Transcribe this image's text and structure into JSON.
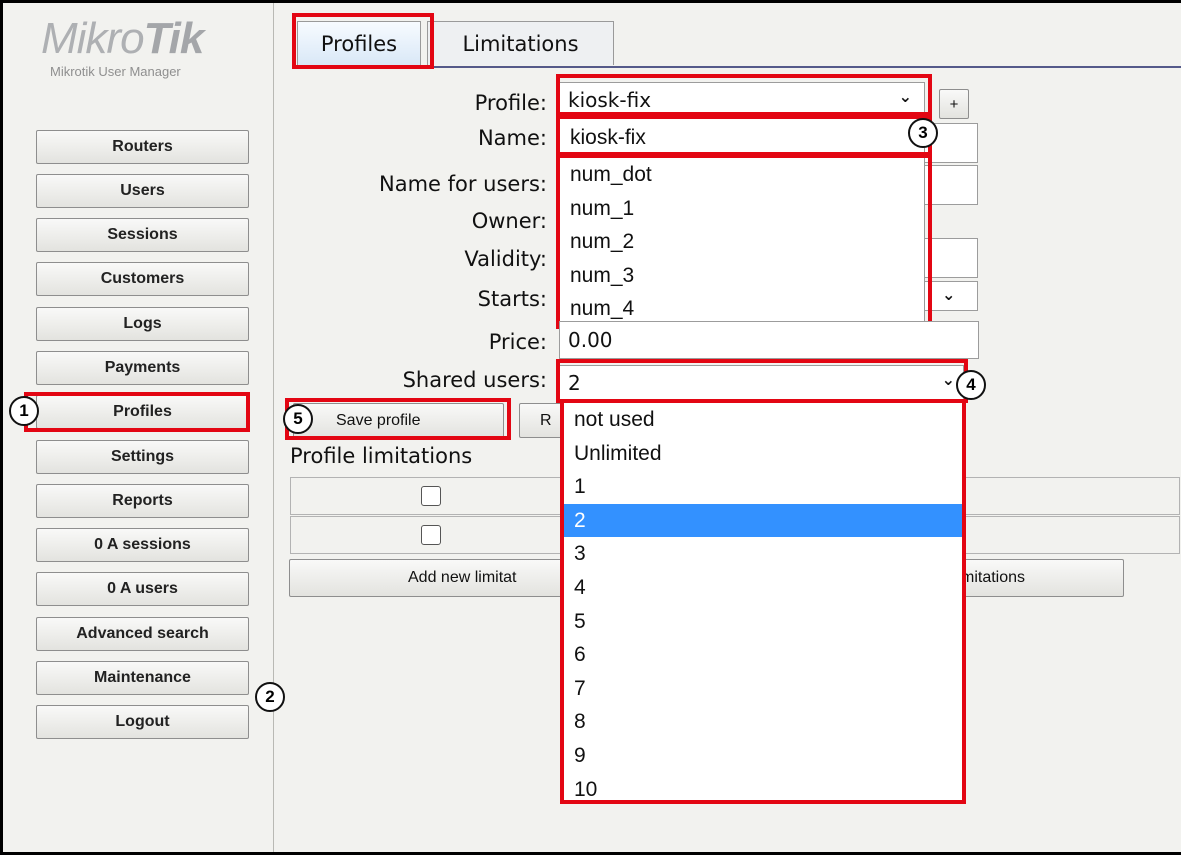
{
  "brand": {
    "logo_light": "Mikro",
    "logo_bold": "Tik",
    "subtitle": "Mikrotik User Manager"
  },
  "sidebar": {
    "items": [
      {
        "label": "Routers"
      },
      {
        "label": "Users"
      },
      {
        "label": "Sessions"
      },
      {
        "label": "Customers"
      },
      {
        "label": "Logs"
      },
      {
        "label": "Payments"
      },
      {
        "label": "Profiles"
      },
      {
        "label": "Settings"
      },
      {
        "label": "Reports"
      },
      {
        "label": "0 A sessions"
      },
      {
        "label": "0 A users"
      },
      {
        "label": "Advanced search"
      },
      {
        "label": "Maintenance"
      },
      {
        "label": "Logout"
      }
    ]
  },
  "tabs": [
    {
      "label": "Profiles",
      "active": true
    },
    {
      "label": "Limitations",
      "active": false
    }
  ],
  "form": {
    "profile_label": "Profile:",
    "profile_value": "kiosk-fix",
    "add_label": "+",
    "name_label": "Name:",
    "name_value": "kiosk-fix",
    "name_for_users_label": "Name for users:",
    "owner_label": "Owner:",
    "validity_label": "Validity:",
    "starts_label": "Starts:",
    "price_label": "Price:",
    "price_value": "0.00",
    "shared_users_label": "Shared users:",
    "shared_users_value": "2"
  },
  "profile_dropdown": {
    "options": [
      "num_dot",
      "num_1",
      "num_2",
      "num_3",
      "num_4"
    ]
  },
  "shared_users_dropdown": {
    "options": [
      "not used",
      "Unlimited",
      "1",
      "2",
      "3",
      "4",
      "5",
      "6",
      "7",
      "8",
      "9",
      "10"
    ],
    "selected": "2"
  },
  "buttons": {
    "save_profile": "Save profile",
    "remove_partial": "R",
    "add_limitation": "Add new limitat",
    "limitations_partial": "mitations"
  },
  "limitations": {
    "title": "Profile limitations"
  },
  "annotations": {
    "b1": "1",
    "b2": "2",
    "b3": "3",
    "b4": "4",
    "b5": "5"
  },
  "colors": {
    "highlight": "#e30613",
    "selection": "#3391ff"
  }
}
